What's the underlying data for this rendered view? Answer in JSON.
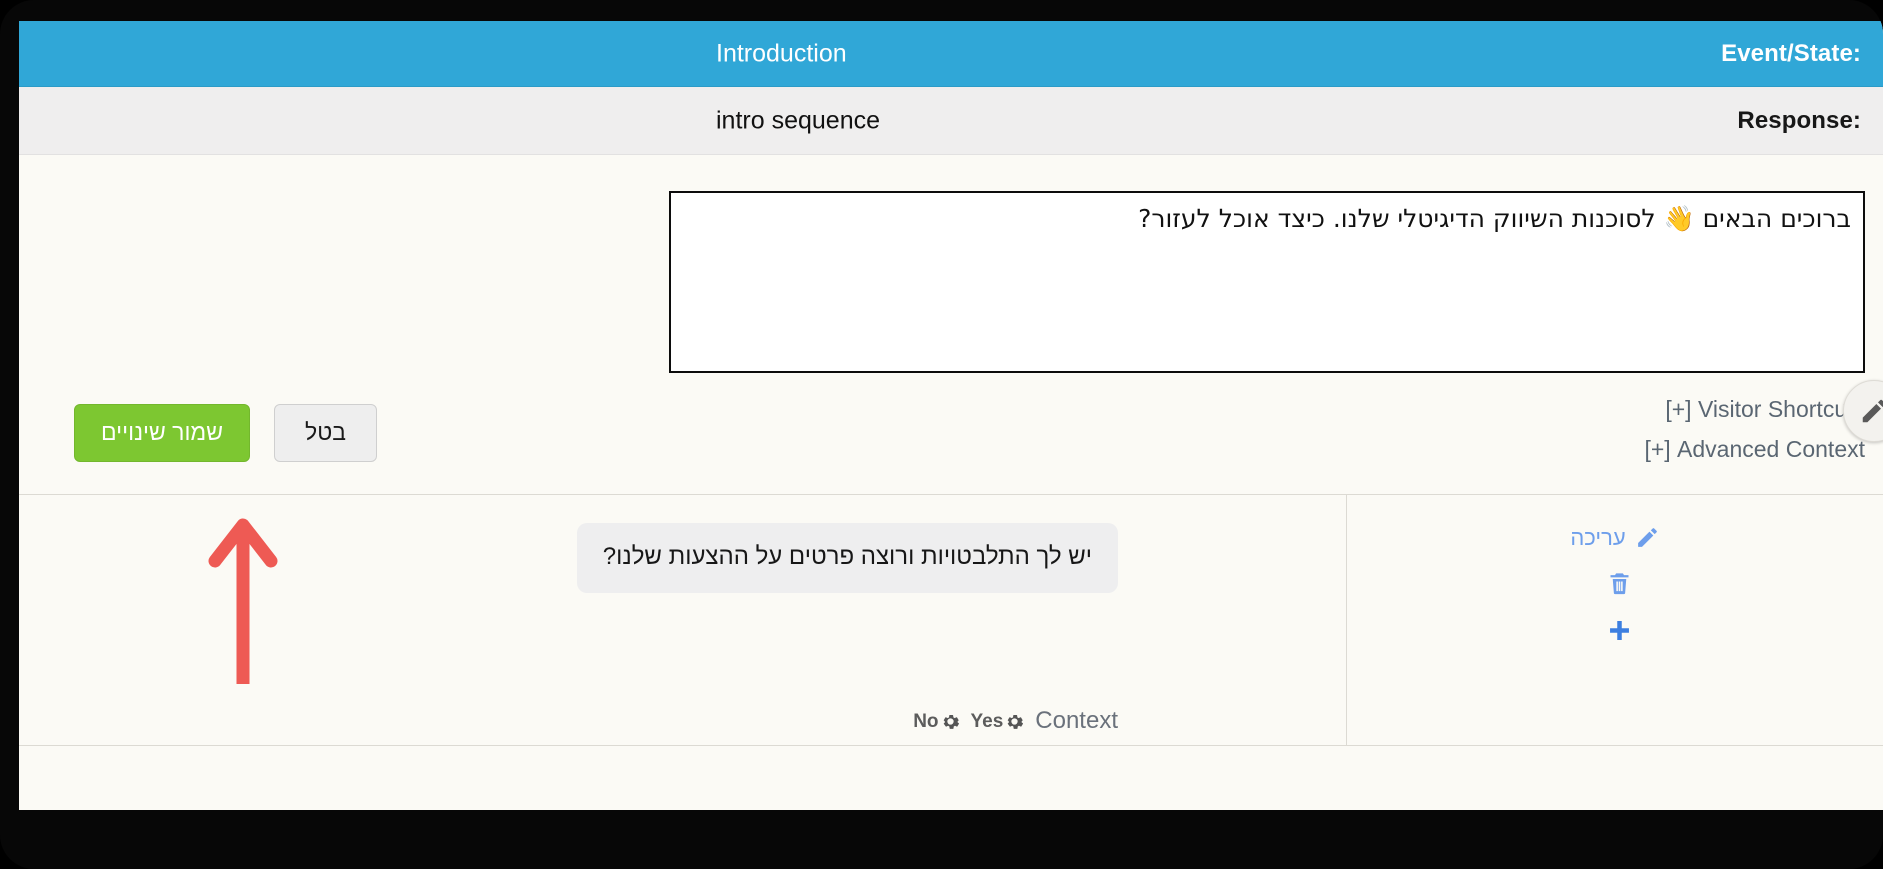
{
  "header": {
    "event_state": {
      "label": ":Event/State",
      "value": "Introduction",
      "bg_color": "#30a7d7",
      "text_color": "#ffffff"
    },
    "response": {
      "label": ":Response",
      "value": "intro sequence",
      "bg_color": "#efeeee",
      "text_color": "#171717"
    }
  },
  "editor": {
    "reply_text": "ברוכים הבאים 👋 לסוכנות השיווק הדיגיטלי שלנו. כיצד אוכל לעזור?",
    "reply_placeholder": "",
    "float_edit_icon": "pencil-icon"
  },
  "collapsibles": [
    {
      "label": "Visitor Shortcuts [+]"
    },
    {
      "label": "Advanced Context [+]"
    }
  ],
  "buttons": {
    "save_label": "שמור שינויים",
    "save_color": "#7dc731",
    "cancel_label": "בטל",
    "cancel_color": "#eeeeee"
  },
  "messages": [
    {
      "text": "יש לך התלבטויות ורוצה פרטים על ההצעות שלנו?"
    }
  ],
  "context": {
    "label": "Context",
    "options": [
      {
        "label": "Yes",
        "icon": "gear-icon"
      },
      {
        "label": "No",
        "icon": "gear-icon"
      }
    ]
  },
  "actions": [
    {
      "label": "עריכה",
      "icon": "pencil-icon",
      "color": "#6d9eeb"
    },
    {
      "label": "",
      "icon": "trash-icon",
      "color": "#6d9eeb"
    },
    {
      "label": "",
      "icon": "plus-icon",
      "color": "#6d9eeb"
    }
  ],
  "annotation": {
    "arrow_color": "#ee5a54",
    "points_to": "שמור שינויים"
  }
}
